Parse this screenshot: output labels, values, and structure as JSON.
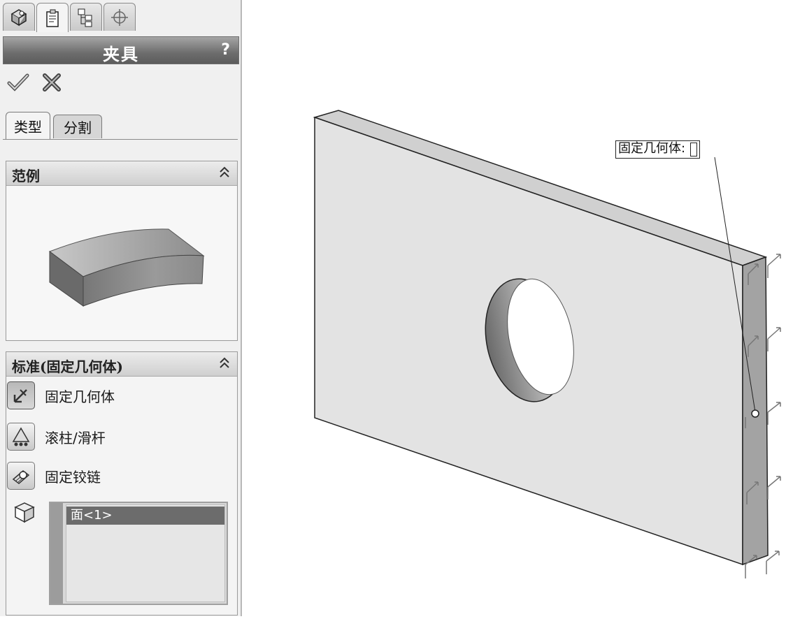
{
  "panel": {
    "top_tabs": [
      {
        "icon": "feature-manager-icon"
      },
      {
        "icon": "property-manager-icon"
      },
      {
        "icon": "configuration-manager-icon"
      },
      {
        "icon": "dim-xpert-icon"
      }
    ],
    "title": "夹具",
    "help": "?",
    "ok_icon": "checkmark-icon",
    "cancel_icon": "x-icon",
    "subtabs": [
      "类型",
      "分割"
    ],
    "example_section": {
      "title": "范例",
      "collapse_icon": "double-chevron-up-icon"
    },
    "standard_section": {
      "title": "标准(固定几何体)",
      "collapse_icon": "double-chevron-up-icon",
      "options": [
        {
          "label": "固定几何体",
          "icon": "fixed-geometry-icon",
          "selected": true
        },
        {
          "label": "滚柱/滑杆",
          "icon": "roller-slider-icon",
          "selected": false
        },
        {
          "label": "固定铰链",
          "icon": "fixed-hinge-icon",
          "selected": false
        }
      ],
      "face_icon": "cube-face-icon",
      "selection_list": [
        "面<1>"
      ]
    }
  },
  "viewport": {
    "callout_label": "固定几何体:"
  },
  "colors": {
    "title_bar": "#6d6d6d",
    "face_front": "#e2e2e2",
    "face_side": "#a3a3a3",
    "selection_highlight": "#6c6c6c"
  }
}
